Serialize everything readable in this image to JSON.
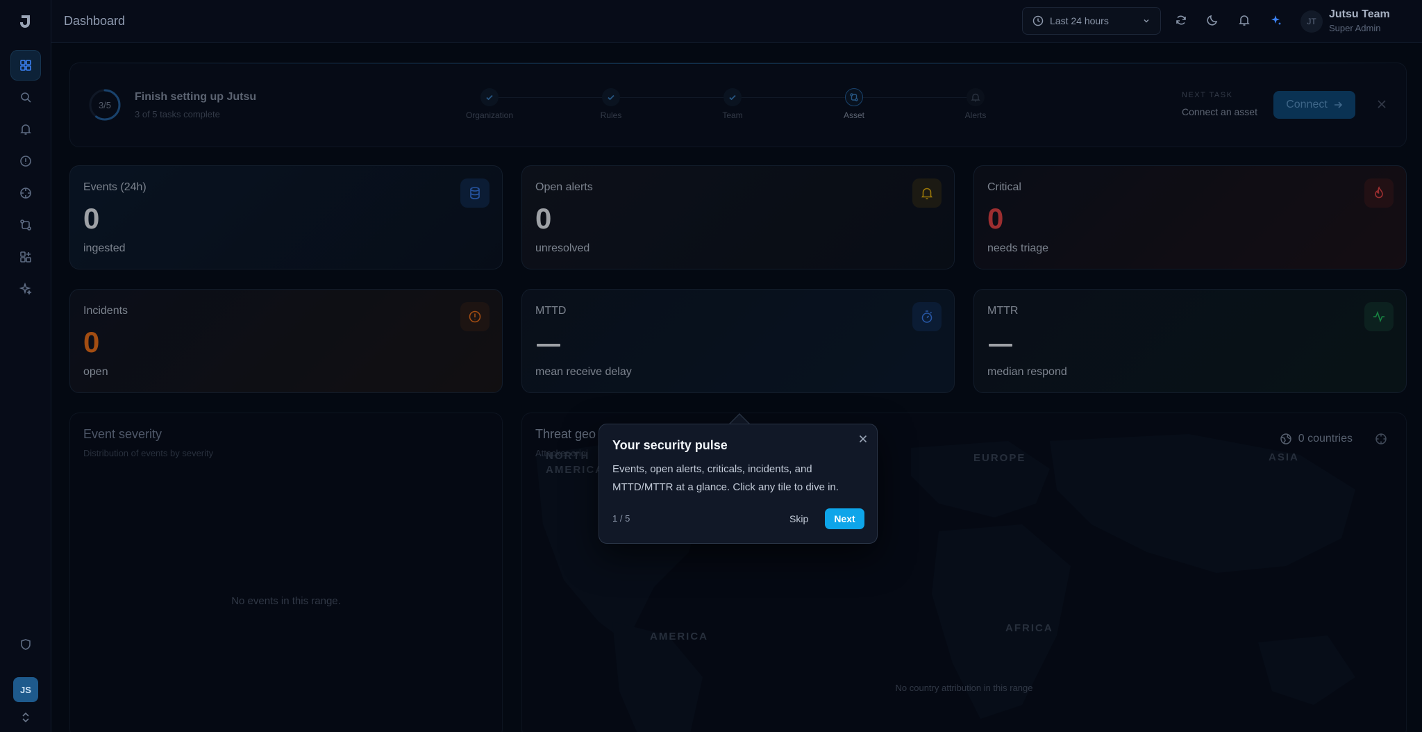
{
  "app": {
    "logo": "J"
  },
  "sidebar": {
    "items": [
      {
        "icon": "grid-icon",
        "active": true
      },
      {
        "icon": "search-icon"
      },
      {
        "icon": "bell-icon"
      },
      {
        "icon": "alert-circle-icon"
      },
      {
        "icon": "crosshair-icon"
      },
      {
        "icon": "workflow-icon"
      },
      {
        "icon": "integrations-icon"
      },
      {
        "icon": "sparkle-icon"
      }
    ],
    "bottom_icon": "shield-icon",
    "user_initials": "JS"
  },
  "topbar": {
    "title": "Dashboard",
    "range_label": "Last 24 hours",
    "user_initials": "JT",
    "user_name": "Jutsu Team",
    "user_role": "Super Admin"
  },
  "onboarding": {
    "progress_text": "3/5",
    "progress_fraction": 0.6,
    "title": "Finish setting up Jutsu",
    "subtitle": "3 of 5 tasks complete",
    "steps": [
      {
        "label": "Organization",
        "state": "done"
      },
      {
        "label": "Rules",
        "state": "done"
      },
      {
        "label": "Team",
        "state": "done"
      },
      {
        "label": "Asset",
        "state": "current"
      },
      {
        "label": "Alerts",
        "state": "pending"
      }
    ],
    "next_task_label": "NEXT TASK",
    "next_task_name": "Connect an asset",
    "connect_label": "Connect"
  },
  "cards": {
    "events": {
      "title": "Events (24h)",
      "value": "0",
      "sub": "ingested",
      "icon": "database-icon",
      "color": "#3b82f6"
    },
    "open_alerts": {
      "title": "Open alerts",
      "value": "0",
      "sub": "unresolved",
      "icon": "bell-icon",
      "color": "#eab308"
    },
    "critical": {
      "title": "Critical",
      "value": "0",
      "sub": "needs triage",
      "icon": "flame-icon",
      "color": "#ef4444"
    },
    "incidents": {
      "title": "Incidents",
      "value": "0",
      "sub": "open",
      "icon": "alert-circle-icon",
      "color": "#f97316"
    },
    "mttd": {
      "title": "MTTD",
      "value": "—",
      "sub": "mean receive delay",
      "icon": "timer-icon",
      "color": "#3b82f6"
    },
    "mttr": {
      "title": "MTTR",
      "value": "—",
      "sub": "median respond",
      "icon": "activity-icon",
      "color": "#22c55e"
    }
  },
  "severity_panel": {
    "title": "Event severity",
    "subtitle": "Distribution of events by severity",
    "empty": "No events in this range."
  },
  "geo_panel": {
    "title": "Threat geo",
    "subtitle": "Attacker origi",
    "countries": "0 countries",
    "regions": [
      "NORTH AMERICA",
      "EUROPE",
      "ASIA",
      "AMERICA",
      "AFRICA"
    ],
    "empty": "No country attribution in this range"
  },
  "tour": {
    "title": "Your security pulse",
    "body": "Events, open alerts, criticals, incidents, and MTTD/MTTR at a glance. Click any tile to dive in.",
    "counter": "1 / 5",
    "skip_label": "Skip",
    "next_label": "Next"
  }
}
